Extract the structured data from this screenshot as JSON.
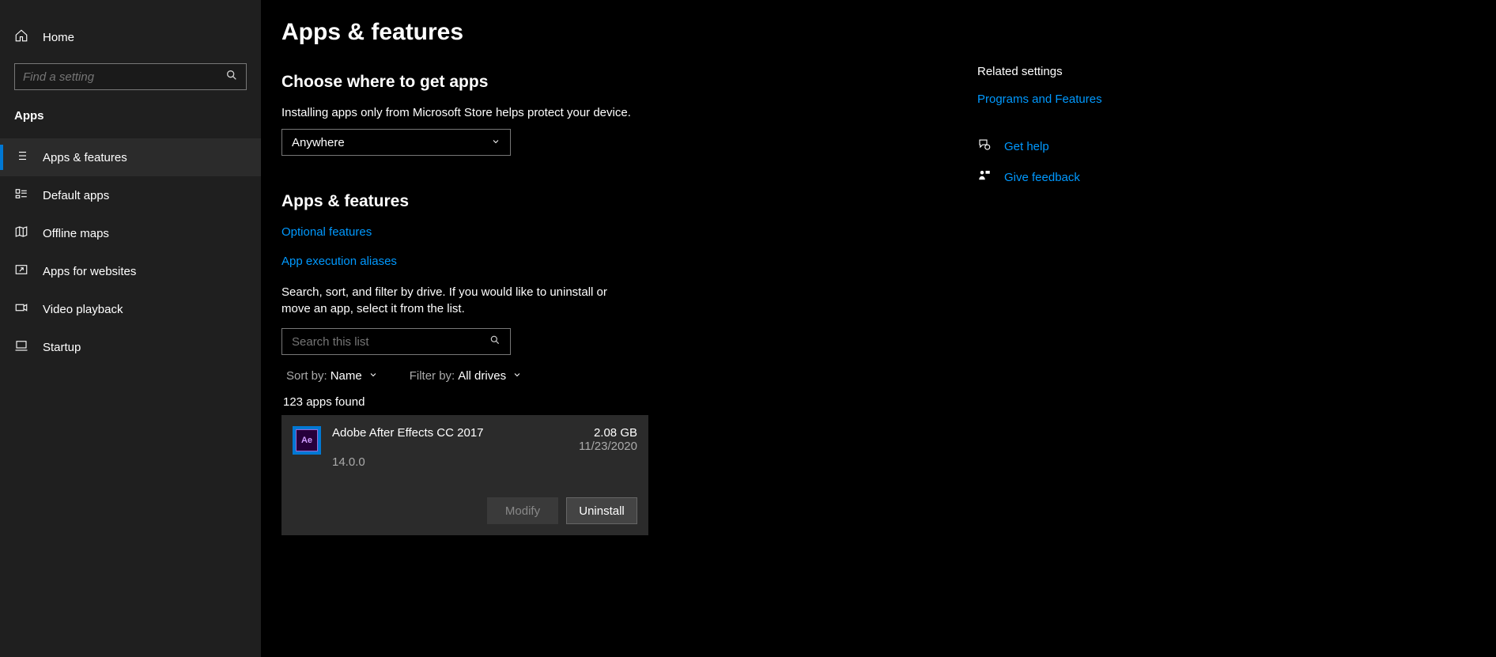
{
  "sidebar": {
    "home": "Home",
    "search_placeholder": "Find a setting",
    "section": "Apps",
    "items": [
      {
        "label": "Apps & features"
      },
      {
        "label": "Default apps"
      },
      {
        "label": "Offline maps"
      },
      {
        "label": "Apps for websites"
      },
      {
        "label": "Video playback"
      },
      {
        "label": "Startup"
      }
    ]
  },
  "main": {
    "title": "Apps & features",
    "choose_heading": "Choose where to get apps",
    "choose_desc": "Installing apps only from Microsoft Store helps protect your device.",
    "dropdown_value": "Anywhere",
    "section_heading": "Apps & features",
    "link_optional": "Optional features",
    "link_aliases": "App execution aliases",
    "help_text": "Search, sort, and filter by drive. If you would like to uninstall or move an app, select it from the list.",
    "list_search_placeholder": "Search this list",
    "sort_label": "Sort by:",
    "sort_value": "Name",
    "filter_label": "Filter by:",
    "filter_value": "All drives",
    "count": "123 apps found",
    "app": {
      "icon_text": "Ae",
      "name": "Adobe After Effects CC 2017",
      "version": "14.0.0",
      "size": "2.08 GB",
      "date": "11/23/2020",
      "modify": "Modify",
      "uninstall": "Uninstall"
    }
  },
  "right": {
    "heading": "Related settings",
    "programs": "Programs and Features",
    "get_help": "Get help",
    "give_feedback": "Give feedback"
  }
}
